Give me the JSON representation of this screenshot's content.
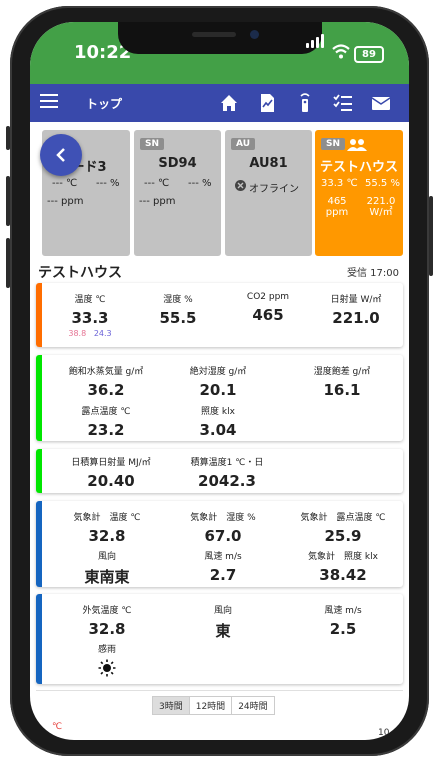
{
  "status": {
    "time": "10:22",
    "battery": "89"
  },
  "appbar": {
    "title": "トップ"
  },
  "cards": [
    {
      "badge": "",
      "name": "ード3",
      "temp": "--- ℃",
      "hum": "--- %",
      "ppm": "--- ppm"
    },
    {
      "badge": "SN",
      "name": "SD94",
      "temp": "--- ℃",
      "hum": "--- %",
      "ppm": "--- ppm"
    },
    {
      "badge": "AU",
      "name": "AU81",
      "offline": "オフライン"
    },
    {
      "badge": "SN",
      "name": "テストハウス",
      "temp": "33.3 ℃",
      "hum": "55.5 %",
      "ppm_val": "465",
      "ppm_unit": "ppm",
      "solar_val": "221.0",
      "solar_unit": "W/㎡"
    }
  ],
  "section": {
    "title": "テストハウス",
    "received": "受信 17:00"
  },
  "panel1": {
    "temp_label": "温度 ℃",
    "temp_value": "33.3",
    "temp_max": "38.8",
    "temp_min": "24.3",
    "hum_label": "湿度 %",
    "hum_value": "55.5",
    "co2_label": "CO2 ppm",
    "co2_value": "465",
    "solar_label": "日射量 W/㎡",
    "solar_value": "221.0"
  },
  "panel2": {
    "sat_label": "飽和水蒸気量 g/㎥",
    "sat_value": "36.2",
    "abs_label": "絶対湿度 g/㎥",
    "abs_value": "20.1",
    "def_label": "湿度飽差 g/㎥",
    "def_value": "16.1",
    "dew_label": "露点温度 ℃",
    "dew_value": "23.2",
    "lux_label": "照度 klx",
    "lux_value": "3.04"
  },
  "panel3": {
    "cum_solar_label": "日積算日射量 MJ/㎡",
    "cum_solar_value": "20.40",
    "cum_temp_label": "積算温度1 ℃・日",
    "cum_temp_value": "2042.3"
  },
  "panel4": {
    "mt_label": "気象計　温度 ℃",
    "mt_value": "32.8",
    "mh_label": "気象計　湿度 %",
    "mh_value": "67.0",
    "md_label": "気象計　露点温度 ℃",
    "md_value": "25.9",
    "wd_label": "風向",
    "wd_value": "東南東",
    "ws_label": "風速 m/s",
    "ws_value": "2.7",
    "ml_label": "気象計　照度 klx",
    "ml_value": "38.42"
  },
  "panel5": {
    "ot_label": "外気温度 ℃",
    "ot_value": "32.8",
    "wd_label": "風向",
    "wd_value": "東",
    "ws_label": "風速 m/s",
    "ws_value": "2.5",
    "rain_label": "感雨"
  },
  "chart_tabs": [
    "3時間",
    "12時間",
    "24時間"
  ],
  "chart_edge": {
    "left_unit": "℃",
    "right_tick": "10"
  },
  "colors": {
    "status": "#43a047",
    "appbar": "#3949ab",
    "orange": "#ff9800",
    "green": "#00e600",
    "blue": "#1565c0"
  }
}
